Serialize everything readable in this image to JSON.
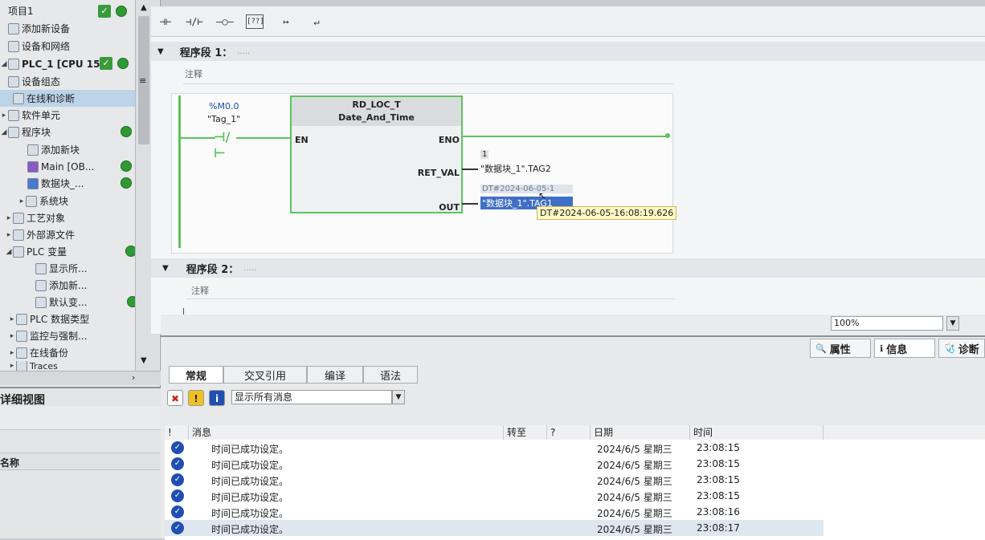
{
  "tree": {
    "project": "项目1",
    "items": [
      {
        "label": "添加新设备"
      },
      {
        "label": "设备和网络"
      },
      {
        "label": "PLC_1 [CPU 15..."
      },
      {
        "label": "设备组态"
      },
      {
        "label": "在线和诊断"
      },
      {
        "label": "软件单元"
      },
      {
        "label": "程序块"
      },
      {
        "label": "添加新块"
      },
      {
        "label": "Main [OB..."
      },
      {
        "label": "数据块_..."
      },
      {
        "label": "系统块"
      },
      {
        "label": "工艺对象"
      },
      {
        "label": "外部源文件"
      },
      {
        "label": "PLC 变量"
      },
      {
        "label": "显示所..."
      },
      {
        "label": "添加新..."
      },
      {
        "label": "默认变..."
      },
      {
        "label": "PLC 数据类型"
      },
      {
        "label": "监控与强制..."
      },
      {
        "label": "在线备份"
      },
      {
        "label": "Traces"
      }
    ]
  },
  "detail_view": {
    "title": "详细视图",
    "col_name": "名称"
  },
  "toolbar": {
    "b1": "⊣⊢",
    "b2": "⊣/⊢",
    "b3": "–○–",
    "b4": "[??]",
    "b5": "↦",
    "b6": "↵"
  },
  "segment1": {
    "title": "程序段 1：",
    "dots": ".....",
    "comment": "注释",
    "contact_addr": "%M0.0",
    "contact_tag": "\"Tag_1\"",
    "block_name": "RD_LOC_T",
    "block_type": "Date_And_Time",
    "pin_en": "EN",
    "pin_eno": "ENO",
    "pin_ret": "RET_VAL",
    "pin_out": "OUT",
    "ret_value": "1",
    "ret_tag": "\"数据块_1\".TAG2",
    "out_value": "DT#2024-06-05-1",
    "out_tag": "\"数据块_1\".TAG1",
    "tooltip": "DT#2024-06-05-16:08:19.626"
  },
  "segment2": {
    "title": "程序段 2：",
    "dots": ".....",
    "comment": "注释"
  },
  "zoom": {
    "value": "100%"
  },
  "inspector": {
    "tabs": {
      "properties": "属性",
      "info": "信息",
      "diagnostics": "诊断"
    },
    "subtabs": {
      "general": "常规",
      "xref": "交叉引用",
      "compile": "编译",
      "syntax": "语法"
    },
    "filter": "显示所有消息",
    "headers": {
      "bang": "!",
      "message": "消息",
      "goto": "转至",
      "q": "?",
      "date": "日期",
      "time": "时间"
    },
    "messages": [
      {
        "text": "时间已成功设定。",
        "date": "2024/6/5 星期三",
        "time": "23:08:15"
      },
      {
        "text": "时间已成功设定。",
        "date": "2024/6/5 星期三",
        "time": "23:08:15"
      },
      {
        "text": "时间已成功设定。",
        "date": "2024/6/5 星期三",
        "time": "23:08:15"
      },
      {
        "text": "时间已成功设定。",
        "date": "2024/6/5 星期三",
        "time": "23:08:15"
      },
      {
        "text": "时间已成功设定。",
        "date": "2024/6/5 星期三",
        "time": "23:08:16"
      },
      {
        "text": "时间已成功设定。",
        "date": "2024/6/5 星期三",
        "time": "23:08:17"
      }
    ]
  },
  "colors": {
    "accent": "#5bc45b",
    "selection": "#3f6fc4",
    "info": "#1f4fb0"
  }
}
